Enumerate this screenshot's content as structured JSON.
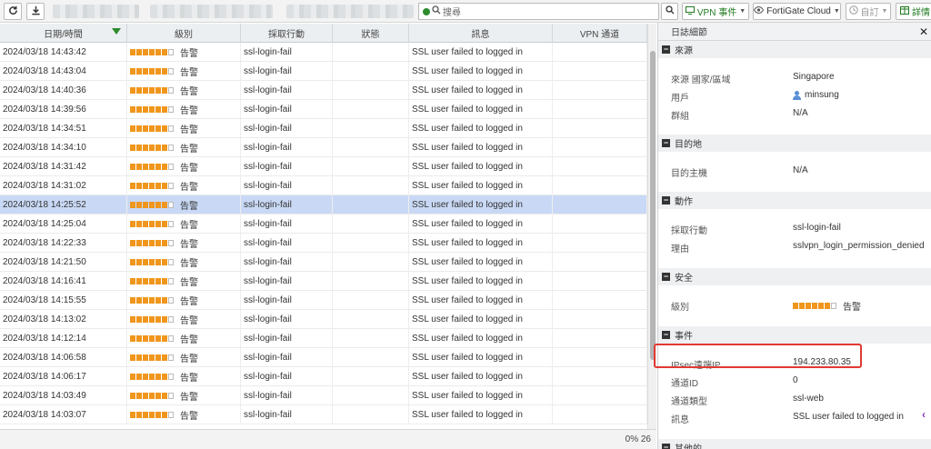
{
  "toolbar": {
    "refresh_icon": "refresh-icon",
    "download_icon": "download-icon",
    "search_placeholder": "搜尋",
    "vpn_events_label": "VPN 事件",
    "fortigate_cloud_label": "FortiGate Cloud",
    "custom_label": "自訂",
    "details_label": "詳情"
  },
  "table": {
    "columns": [
      "日期/時間",
      "級別",
      "採取行動",
      "狀態",
      "訊息",
      "VPN 通道"
    ],
    "rows": [
      {
        "time": "2024/03/18 14:43:42",
        "level": "告警",
        "action": "ssl-login-fail",
        "status": "",
        "message": "SSL user failed to logged in",
        "vpn": ""
      },
      {
        "time": "2024/03/18 14:43:04",
        "level": "告警",
        "action": "ssl-login-fail",
        "status": "",
        "message": "SSL user failed to logged in",
        "vpn": ""
      },
      {
        "time": "2024/03/18 14:40:36",
        "level": "告警",
        "action": "ssl-login-fail",
        "status": "",
        "message": "SSL user failed to logged in",
        "vpn": ""
      },
      {
        "time": "2024/03/18 14:39:56",
        "level": "告警",
        "action": "ssl-login-fail",
        "status": "",
        "message": "SSL user failed to logged in",
        "vpn": ""
      },
      {
        "time": "2024/03/18 14:34:51",
        "level": "告警",
        "action": "ssl-login-fail",
        "status": "",
        "message": "SSL user failed to logged in",
        "vpn": ""
      },
      {
        "time": "2024/03/18 14:34:10",
        "level": "告警",
        "action": "ssl-login-fail",
        "status": "",
        "message": "SSL user failed to logged in",
        "vpn": ""
      },
      {
        "time": "2024/03/18 14:31:42",
        "level": "告警",
        "action": "ssl-login-fail",
        "status": "",
        "message": "SSL user failed to logged in",
        "vpn": ""
      },
      {
        "time": "2024/03/18 14:31:02",
        "level": "告警",
        "action": "ssl-login-fail",
        "status": "",
        "message": "SSL user failed to logged in",
        "vpn": ""
      },
      {
        "time": "2024/03/18 14:25:52",
        "level": "告警",
        "action": "ssl-login-fail",
        "status": "",
        "message": "SSL user failed to logged in",
        "vpn": "",
        "selected": true
      },
      {
        "time": "2024/03/18 14:25:04",
        "level": "告警",
        "action": "ssl-login-fail",
        "status": "",
        "message": "SSL user failed to logged in",
        "vpn": ""
      },
      {
        "time": "2024/03/18 14:22:33",
        "level": "告警",
        "action": "ssl-login-fail",
        "status": "",
        "message": "SSL user failed to logged in",
        "vpn": ""
      },
      {
        "time": "2024/03/18 14:21:50",
        "level": "告警",
        "action": "ssl-login-fail",
        "status": "",
        "message": "SSL user failed to logged in",
        "vpn": ""
      },
      {
        "time": "2024/03/18 14:16:41",
        "level": "告警",
        "action": "ssl-login-fail",
        "status": "",
        "message": "SSL user failed to logged in",
        "vpn": ""
      },
      {
        "time": "2024/03/18 14:15:55",
        "level": "告警",
        "action": "ssl-login-fail",
        "status": "",
        "message": "SSL user failed to logged in",
        "vpn": ""
      },
      {
        "time": "2024/03/18 14:13:02",
        "level": "告警",
        "action": "ssl-login-fail",
        "status": "",
        "message": "SSL user failed to logged in",
        "vpn": ""
      },
      {
        "time": "2024/03/18 14:12:14",
        "level": "告警",
        "action": "ssl-login-fail",
        "status": "",
        "message": "SSL user failed to logged in",
        "vpn": ""
      },
      {
        "time": "2024/03/18 14:06:58",
        "level": "告警",
        "action": "ssl-login-fail",
        "status": "",
        "message": "SSL user failed to logged in",
        "vpn": ""
      },
      {
        "time": "2024/03/18 14:06:17",
        "level": "告警",
        "action": "ssl-login-fail",
        "status": "",
        "message": "SSL user failed to logged in",
        "vpn": ""
      },
      {
        "time": "2024/03/18 14:03:49",
        "level": "告警",
        "action": "ssl-login-fail",
        "status": "",
        "message": "SSL user failed to logged in",
        "vpn": ""
      },
      {
        "time": "2024/03/18 14:03:07",
        "level": "告警",
        "action": "ssl-login-fail",
        "status": "",
        "message": "SSL user failed to logged in",
        "vpn": ""
      }
    ],
    "severity_level_filled": 6,
    "severity_level_total": 7
  },
  "status_bar": {
    "text": "0% 26"
  },
  "details": {
    "title": "日誌細節",
    "source": {
      "heading": "來源",
      "country_label": "來源 國家/區域",
      "country": "Singapore",
      "user_label": "用戶",
      "user": "minsung",
      "group_label": "群組",
      "group": "N/A"
    },
    "destination": {
      "heading": "目的地",
      "host_label": "目的主機",
      "host": "N/A"
    },
    "action": {
      "heading": "動作",
      "action_label": "採取行動",
      "action": "ssl-login-fail",
      "reason_label": "理由",
      "reason": "sslvpn_login_permission_denied"
    },
    "security": {
      "heading": "安全",
      "level_label": "級別",
      "level": "告警"
    },
    "event": {
      "heading": "事件",
      "ip_label": "IPsec遠端IP",
      "ip": "194.233.80.35",
      "tunnel_id_label": "通道ID",
      "tunnel_id": "0",
      "tunnel_type_label": "通道類型",
      "tunnel_type": "ssl-web",
      "message_label": "訊息",
      "message": "SSL user failed to logged in"
    },
    "other": {
      "heading": "其他的"
    }
  },
  "colors": {
    "severity": "#f0961c",
    "selected_row": "#c9d9f5",
    "highlight_box": "#e03a33"
  }
}
